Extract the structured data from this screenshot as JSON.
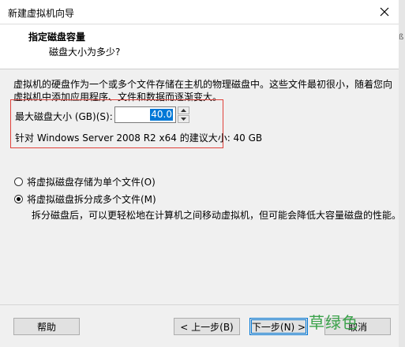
{
  "window": {
    "title": "新建虚拟机向导"
  },
  "header": {
    "title": "指定磁盘容量",
    "subtitle": "磁盘大小为多少?"
  },
  "description": "虚拟机的硬盘作为一个或多个文件存储在主机的物理磁盘中。这些文件最初很小，随着您向虚拟机中添加应用程序、文件和数据而逐渐变大。",
  "disk": {
    "label": "最大磁盘大小 (GB)(S):",
    "value": "40.0",
    "recommendation": "针对 Windows Server 2008 R2 x64 的建议大小: 40 GB"
  },
  "options": [
    {
      "label": "将虚拟磁盘存储为单个文件(O)",
      "selected": false
    },
    {
      "label": "将虚拟磁盘拆分成多个文件(M)",
      "selected": true
    }
  ],
  "split_description": "拆分磁盘后，可以更轻松地在计算机之间移动虚拟机，但可能会降低大容量磁盘的性能。",
  "buttons": {
    "help": "帮助",
    "back": "< 上一步(B)",
    "next": "下一步(N) >",
    "cancel": "取消"
  },
  "watermark": "草绿色",
  "edge_glyph": "ß",
  "colors": {
    "highlight_box": "#e0413a",
    "selection": "#0078d7",
    "watermark": "#3aa24a"
  }
}
